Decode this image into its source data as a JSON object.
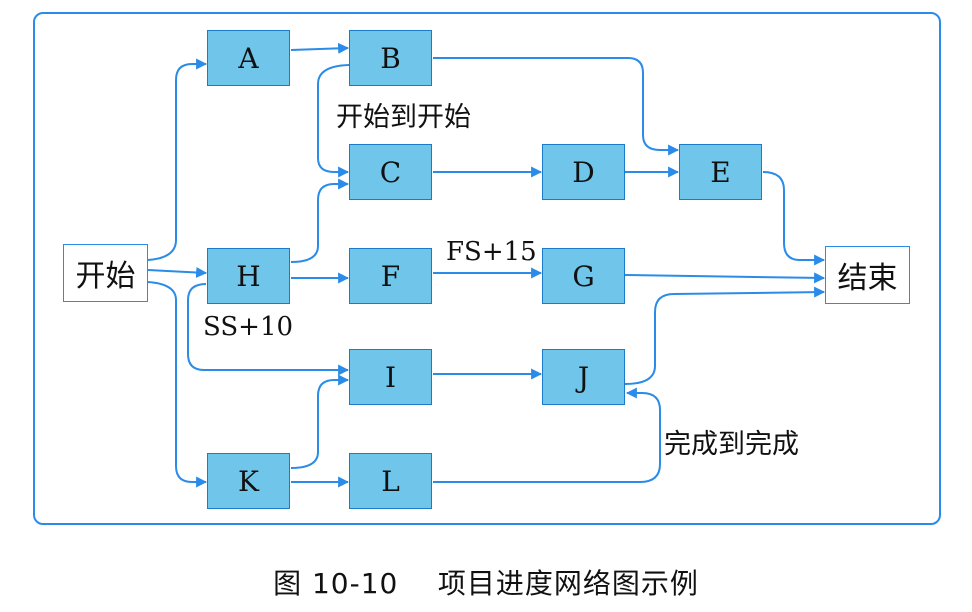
{
  "diagram": {
    "nodes": {
      "start": "开始",
      "A": "A",
      "B": "B",
      "C": "C",
      "D": "D",
      "E": "E",
      "F": "F",
      "G": "G",
      "H": "H",
      "I": "I",
      "J": "J",
      "K": "K",
      "L": "L",
      "end": "结束"
    },
    "edge_labels": {
      "b_to_c": "开始到开始",
      "h_ss": "SS+10",
      "f_to_g": "FS+15",
      "l_to_j": "完成到完成"
    },
    "edges": [
      [
        "开始",
        "A"
      ],
      [
        "开始",
        "H"
      ],
      [
        "开始",
        "K"
      ],
      [
        "A",
        "B"
      ],
      [
        "B",
        "C"
      ],
      [
        "B",
        "E"
      ],
      [
        "C",
        "D"
      ],
      [
        "D",
        "E"
      ],
      [
        "E",
        "结束"
      ],
      [
        "H",
        "C"
      ],
      [
        "H",
        "F"
      ],
      [
        "H",
        "I"
      ],
      [
        "F",
        "G"
      ],
      [
        "G",
        "结束"
      ],
      [
        "K",
        "I"
      ],
      [
        "K",
        "L"
      ],
      [
        "I",
        "J"
      ],
      [
        "J",
        "结束"
      ],
      [
        "L",
        "J"
      ]
    ],
    "color": "#2a8ce8",
    "task_fill": "#6fc6ea"
  },
  "caption": "图 10-10    项目进度网络图示例"
}
